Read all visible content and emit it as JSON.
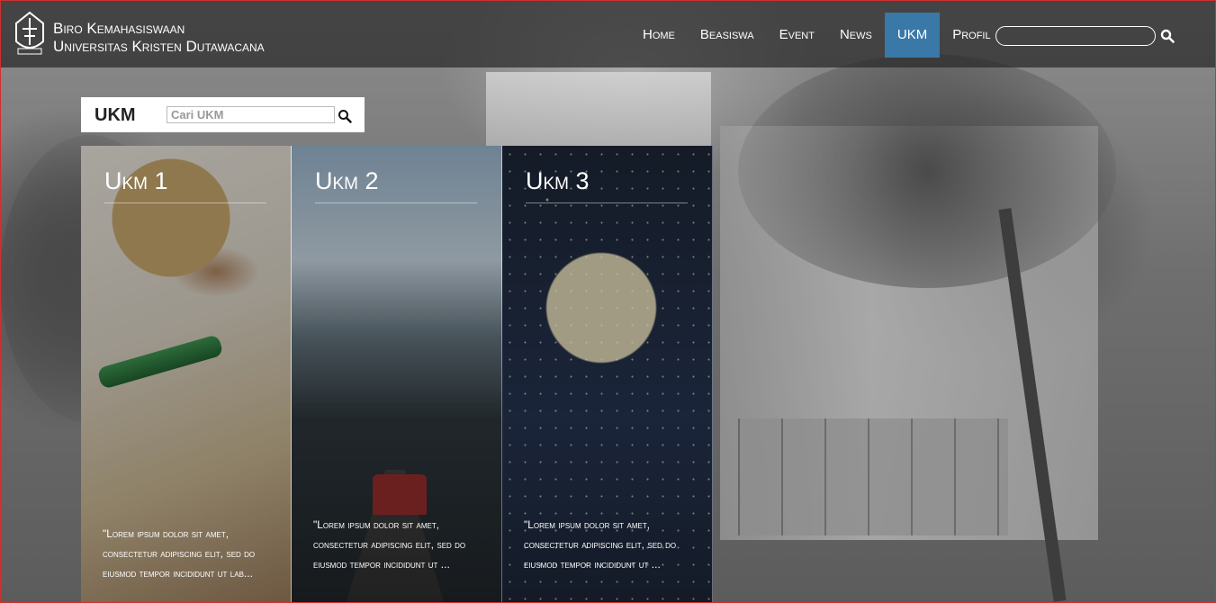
{
  "header": {
    "brand_line1": "Biro Kemahasiswaan",
    "brand_line2": "Universitas Kristen Dutawacana",
    "logo_icon": "university-crest-icon"
  },
  "nav": {
    "items": [
      {
        "label": "Home",
        "active": false
      },
      {
        "label": "Beasiswa",
        "active": false
      },
      {
        "label": "Event",
        "active": false
      },
      {
        "label": "News",
        "active": false
      },
      {
        "label": "UKM",
        "active": true
      },
      {
        "label": "Profil",
        "active": false
      }
    ],
    "search_placeholder": "",
    "search_icon": "search-icon",
    "active_color": "#3a78a8"
  },
  "ukm_section": {
    "title": "UKM",
    "search_placeholder": "Cari UKM",
    "search_icon": "search-icon"
  },
  "cards": [
    {
      "title": "Ukm 1",
      "text": "\"Lorem ipsum dolor sit amet, consectetur adipiscing elit, sed do eiusmod tempor incididunt ut lab..."
    },
    {
      "title": "Ukm 2",
      "text": "\"Lorem ipsum dolor sit amet, consectetur adipiscing elit, sed do eiusmod tempor incididunt ut ..."
    },
    {
      "title": "Ukm 3",
      "text": "\"Lorem ipsum dolor sit amet, consectetur adipiscing elit, sed do eiusmod tempor incididunt ut ..."
    }
  ]
}
